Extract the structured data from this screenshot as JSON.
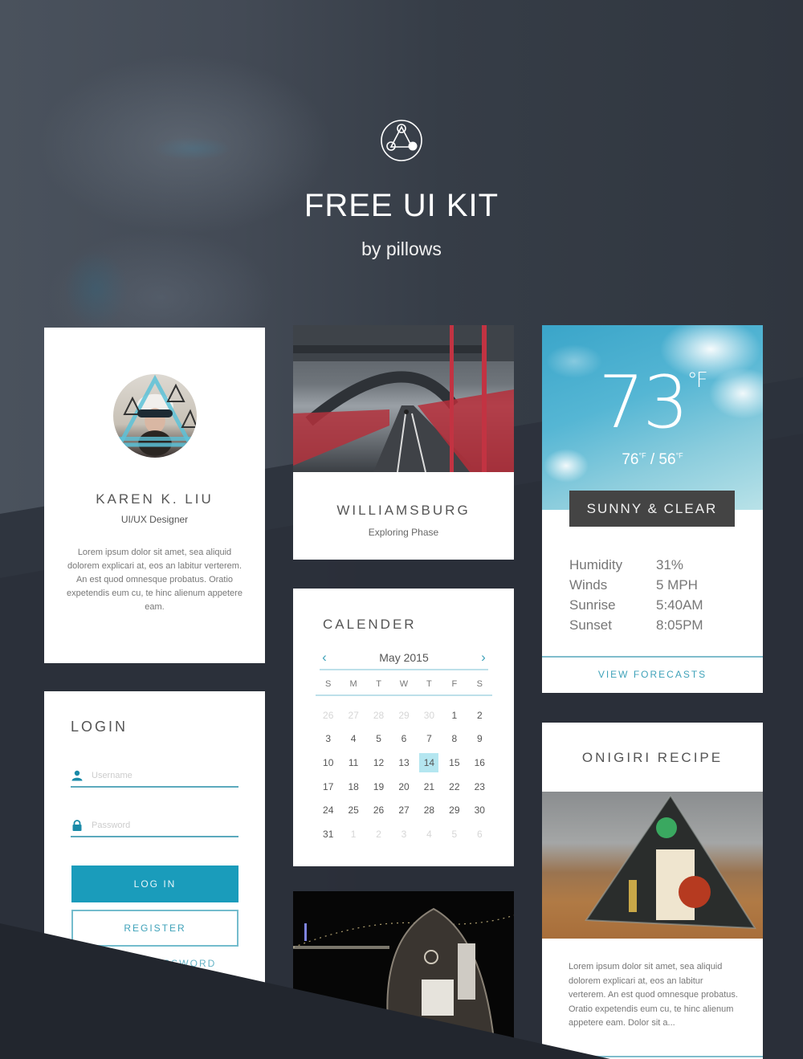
{
  "header": {
    "logo_icon": "triangle-circles-logo-icon",
    "title": "FREE UI KIT",
    "subtitle": "by pillows"
  },
  "profile": {
    "avatar_alt": "Karen K. Liu avatar photo",
    "name": "KAREN K. LIU",
    "role": "UI/UX Designer",
    "bio": "Lorem ipsum dolor sit amet, sea aliquid dolorem explicari at, eos an labitur verterem. An est quod omnesque probatus. Oratio expetendis eum cu, te hinc alienum appetere eam."
  },
  "login": {
    "heading": "LOGIN",
    "username": {
      "icon": "user-icon",
      "placeholder": "Username",
      "value": ""
    },
    "password": {
      "icon": "lock-icon",
      "placeholder": "Password",
      "value": ""
    },
    "login_label": "LOG IN",
    "register_label": "REGISTER",
    "forgot_label": "FORGOT PASSWORD"
  },
  "location_card": {
    "photo_alt": "Williamsburg bridge bike path photo",
    "title": "WILLIAMSBURG",
    "subtitle": "Exploring Phase"
  },
  "calendar": {
    "heading": "CALENDER",
    "month_label": "May 2015",
    "prev_icon": "chevron-left-icon",
    "next_icon": "chevron-right-icon",
    "weekdays": [
      "S",
      "M",
      "T",
      "W",
      "T",
      "F",
      "S"
    ],
    "days": [
      {
        "d": "26",
        "muted": true
      },
      {
        "d": "27",
        "muted": true
      },
      {
        "d": "28",
        "muted": true
      },
      {
        "d": "29",
        "muted": true
      },
      {
        "d": "30",
        "muted": true
      },
      {
        "d": "1"
      },
      {
        "d": "2"
      },
      {
        "d": "3"
      },
      {
        "d": "4"
      },
      {
        "d": "5"
      },
      {
        "d": "6"
      },
      {
        "d": "7"
      },
      {
        "d": "8"
      },
      {
        "d": "9"
      },
      {
        "d": "10"
      },
      {
        "d": "11"
      },
      {
        "d": "12"
      },
      {
        "d": "13"
      },
      {
        "d": "14",
        "today": true
      },
      {
        "d": "15"
      },
      {
        "d": "16"
      },
      {
        "d": "17"
      },
      {
        "d": "18"
      },
      {
        "d": "19"
      },
      {
        "d": "20"
      },
      {
        "d": "21"
      },
      {
        "d": "22"
      },
      {
        "d": "23"
      },
      {
        "d": "24"
      },
      {
        "d": "25"
      },
      {
        "d": "26"
      },
      {
        "d": "27"
      },
      {
        "d": "28"
      },
      {
        "d": "29"
      },
      {
        "d": "30"
      },
      {
        "d": "31"
      },
      {
        "d": "1",
        "muted": true
      },
      {
        "d": "2",
        "muted": true
      },
      {
        "d": "3",
        "muted": true
      },
      {
        "d": "4",
        "muted": true
      },
      {
        "d": "5",
        "muted": true
      },
      {
        "d": "6",
        "muted": true
      }
    ],
    "selected_day": "14"
  },
  "night_photo": {
    "alt": "Night photo of glass pod sculpture by the river"
  },
  "weather": {
    "temperature": "73",
    "temp_unit": "°F",
    "high": "76",
    "low": "56",
    "hilo_unit": "°F",
    "condition": "SUNNY & CLEAR",
    "stats": [
      {
        "label": "Humidity",
        "value": "31%"
      },
      {
        "label": "Winds",
        "value": "5 MPH"
      },
      {
        "label": "Sunrise",
        "value": "5:40AM"
      },
      {
        "label": "Sunset",
        "value": "8:05PM"
      }
    ],
    "forecast_label": "VIEW FORECASTS"
  },
  "recipe": {
    "heading": "ONIGIRI RECIPE",
    "photo_alt": "Onigiri rice ball photo",
    "body": "Lorem ipsum dolor sit amet, sea aliquid dolorem explicari at, eos an labitur verterem. An est quod omnesque probatus. Oratio expetendis eum cu, te hinc alienum appetere eam. Dolor sit a..."
  },
  "colors": {
    "accent": "#1a9cbb",
    "accent_light": "#b4e6f0",
    "background": "#2b313b",
    "card": "#ffffff",
    "condition_badge": "#444444"
  }
}
